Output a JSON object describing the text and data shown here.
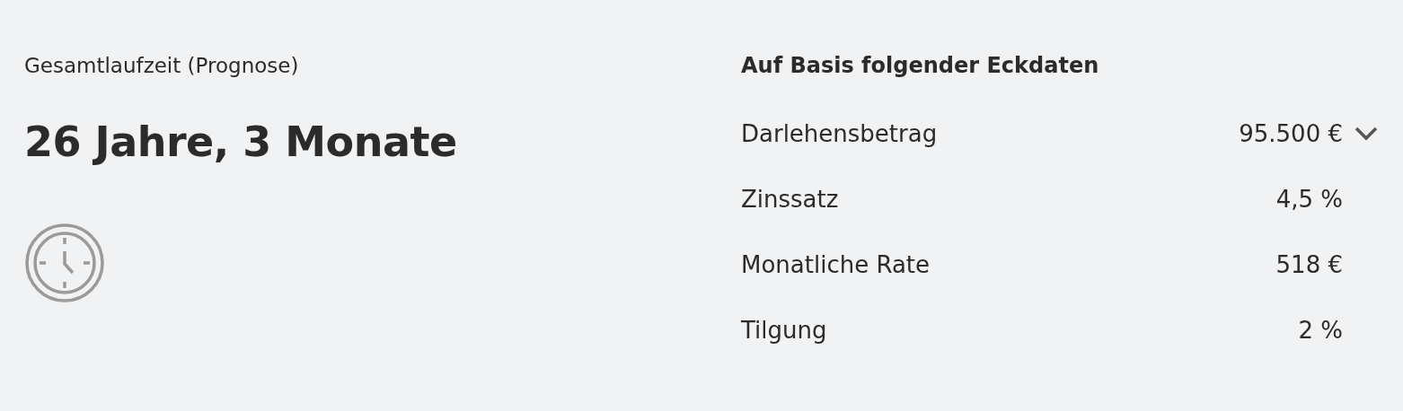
{
  "duration": {
    "label": "Gesamtlaufzeit (Prognose)",
    "value": "26 Jahre, 3 Monate"
  },
  "details": {
    "heading": "Auf Basis folgender Eckdaten",
    "rows": [
      {
        "label": "Darlehensbetrag",
        "value": "95.500 €",
        "kind": "expandable"
      },
      {
        "label": "Zinssatz",
        "value": "4,5 %",
        "kind": "plain"
      },
      {
        "label": "Monatliche Rate",
        "value": "518 €",
        "kind": "plain"
      },
      {
        "label": "Tilgung",
        "value": "2 %",
        "kind": "plain"
      }
    ]
  }
}
